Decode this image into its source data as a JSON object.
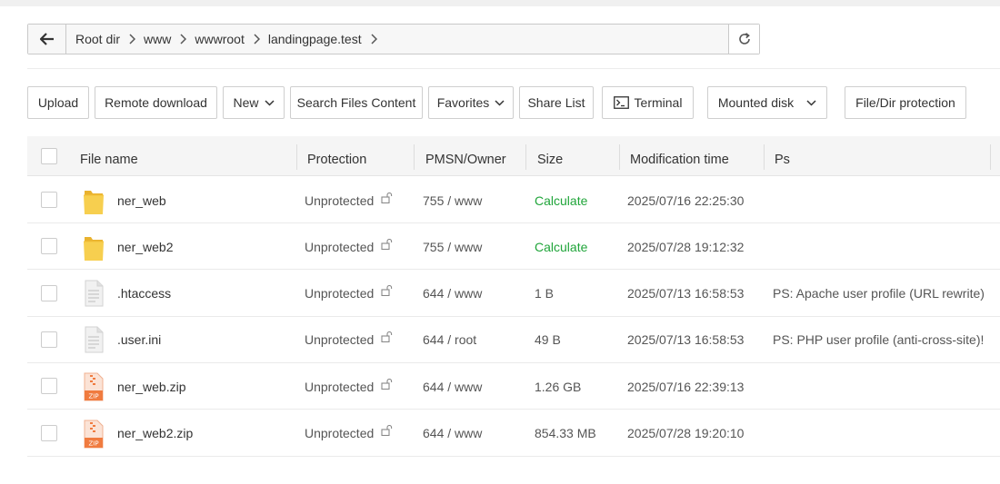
{
  "pathbar": {
    "crumbs": [
      "Root dir",
      "www",
      "wwwroot",
      "landingpage.test"
    ],
    "back_icon": "arrow-left-icon",
    "refresh_icon": "refresh-icon"
  },
  "toolbar": {
    "upload": "Upload",
    "remote_download": "Remote download",
    "new": "New",
    "search_files_content": "Search Files Content",
    "favorites": "Favorites",
    "share_list": "Share List",
    "terminal": "Terminal",
    "mounted_disk": "Mounted disk",
    "file_dir_protection": "File/Dir protection"
  },
  "table": {
    "columns": {
      "name": "File name",
      "protection": "Protection",
      "pmsn": "PMSN/Owner",
      "size": "Size",
      "mtime": "Modification time",
      "ps": "Ps"
    },
    "rows": [
      {
        "type": "folder",
        "name": "ner_web",
        "protection": "Unprotected",
        "pmsn": "755 / www",
        "size": "Calculate",
        "mtime": "2025/07/16 22:25:30",
        "ps": ""
      },
      {
        "type": "folder",
        "name": "ner_web2",
        "protection": "Unprotected",
        "pmsn": "755 / www",
        "size": "Calculate",
        "mtime": "2025/07/28 19:12:32",
        "ps": ""
      },
      {
        "type": "file",
        "name": ".htaccess",
        "protection": "Unprotected",
        "pmsn": "644 / www",
        "size": "1 B",
        "mtime": "2025/07/13 16:58:53",
        "ps": "PS: Apache user profile (URL rewrite)"
      },
      {
        "type": "file",
        "name": ".user.ini",
        "protection": "Unprotected",
        "pmsn": "644 / root",
        "size": "49 B",
        "mtime": "2025/07/13 16:58:53",
        "ps": "PS: PHP user profile (anti-cross-site)!"
      },
      {
        "type": "zip",
        "name": "ner_web.zip",
        "protection": "Unprotected",
        "pmsn": "644 / www",
        "size": "1.26 GB",
        "mtime": "2025/07/16 22:39:13",
        "ps": ""
      },
      {
        "type": "zip",
        "name": "ner_web2.zip",
        "protection": "Unprotected",
        "pmsn": "644 / www",
        "size": "854.33 MB",
        "mtime": "2025/07/28 19:20:10",
        "ps": ""
      }
    ]
  },
  "colors": {
    "calculate": "#20a53a",
    "folder": "#f5c542",
    "zip": "#f07b3f"
  }
}
